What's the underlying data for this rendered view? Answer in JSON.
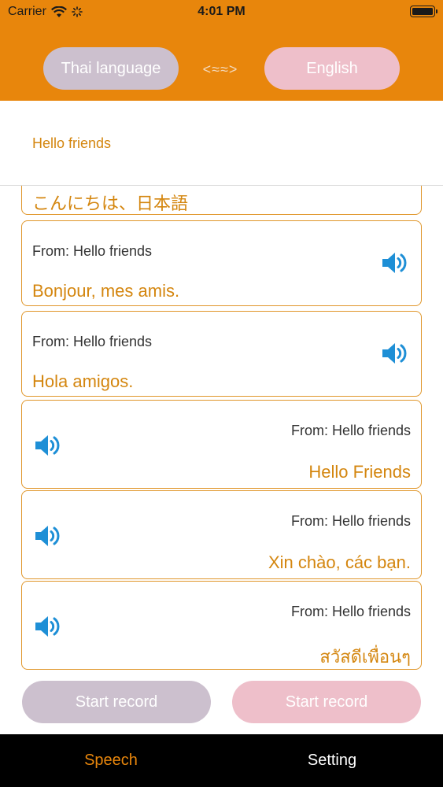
{
  "status_bar": {
    "carrier": "Carrier",
    "time": "4:01 PM"
  },
  "header": {
    "source_lang": "Thai language",
    "swap_label": "<≈≈>",
    "target_lang": "English"
  },
  "input": {
    "text": "Hello friends"
  },
  "cards": [
    {
      "translation": "こんにちは、日本語"
    },
    {
      "from": "From: Hello friends",
      "translation": "Bonjour, mes amis."
    },
    {
      "from": "From: Hello friends",
      "translation": "Hola amigos."
    },
    {
      "from": "From: Hello friends",
      "translation": "Hello Friends"
    },
    {
      "from": "From: Hello friends",
      "translation": "Xin chào, các bạn."
    },
    {
      "from": "From: Hello friends",
      "translation": "สวัสดีเพื่อนๆ"
    }
  ],
  "buttons": {
    "record_left": "Start record",
    "record_right": "Start record"
  },
  "tabs": [
    {
      "label": "Speech"
    },
    {
      "label": "Setting"
    }
  ],
  "colors": {
    "accent": "#e8860c",
    "translation_text": "#d4860f",
    "speaker_icon": "#1e8fd6",
    "left_button": "#ccc0ce",
    "right_button": "#eebfca"
  },
  "icons": [
    "wifi-icon",
    "activity-icon",
    "battery-icon",
    "speaker-icon"
  ]
}
